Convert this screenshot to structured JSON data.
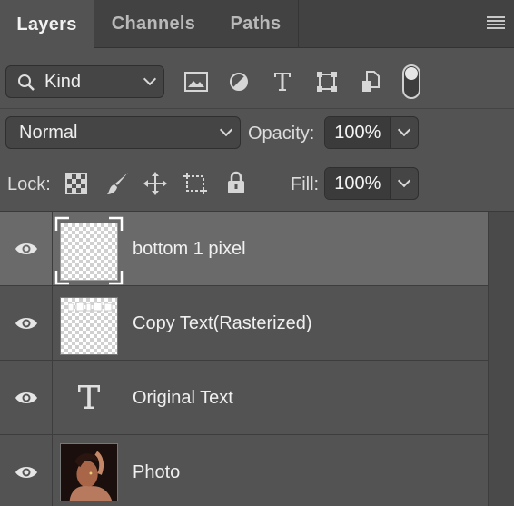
{
  "tabs": [
    {
      "label": "Layers",
      "active": true
    },
    {
      "label": "Channels",
      "active": false
    },
    {
      "label": "Paths",
      "active": false
    }
  ],
  "filter": {
    "kind_label": "Kind",
    "icons": [
      "image-filter-icon",
      "adjustment-filter-icon",
      "type-filter-icon",
      "shape-filter-icon",
      "smart-object-filter-icon",
      "filter-toggle-switch"
    ]
  },
  "blend": {
    "mode": "Normal",
    "opacity_label": "Opacity:",
    "opacity_value": "100%"
  },
  "lock": {
    "label": "Lock:",
    "icons": [
      "lock-transparent-pixels-icon",
      "lock-image-pixels-icon",
      "lock-position-icon",
      "lock-artboard-icon",
      "lock-all-icon"
    ],
    "fill_label": "Fill:",
    "fill_value": "100%"
  },
  "layers": [
    {
      "name": "bottom 1 pixel",
      "selected": true,
      "thumb": "transparent-thumbnail",
      "visible": true
    },
    {
      "name": "Copy Text(Rasterized)",
      "selected": false,
      "thumb": "rasterized-text-thumbnail",
      "visible": true
    },
    {
      "name": "Original Text",
      "selected": false,
      "thumb": "type-layer-icon",
      "visible": true
    },
    {
      "name": "Photo",
      "selected": false,
      "thumb": "photo-thumbnail",
      "visible": true
    }
  ],
  "colors": {
    "panel_bg": "#535353",
    "tab_bar_bg": "#424242",
    "selected_row": "#6a6a6a"
  }
}
